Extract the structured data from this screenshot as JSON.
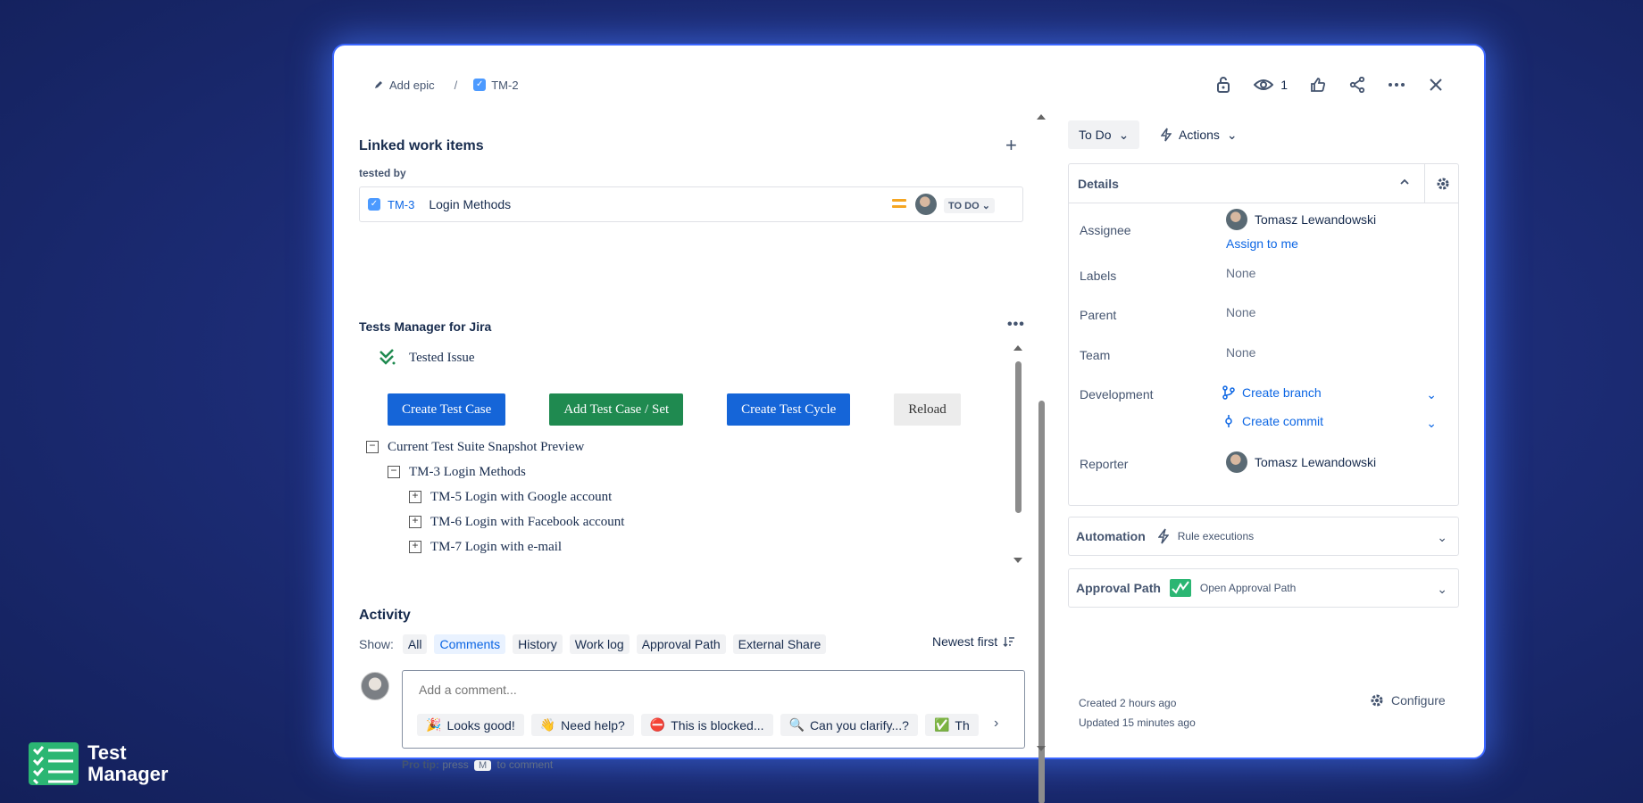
{
  "breadcrumb": {
    "add_epic": "Add epic",
    "sep": "/",
    "issue_key": "TM-2"
  },
  "top_actions": {
    "watch_count": "1"
  },
  "linked": {
    "title": "Linked work items",
    "relation": "tested by",
    "item": {
      "key": "TM-3",
      "summary": "Login Methods",
      "status": "TO DO"
    }
  },
  "tm": {
    "title": "Tests Manager for Jira",
    "tested_issue": "Tested Issue",
    "buttons": {
      "create_case": "Create Test Case",
      "add_case": "Add Test Case / Set",
      "create_cycle": "Create Test Cycle",
      "reload": "Reload"
    },
    "tree": [
      {
        "label": "Current Test Suite Snapshot Preview",
        "toggle": "−"
      },
      {
        "label": "TM-3 Login Methods",
        "toggle": "−"
      },
      {
        "label": "TM-5 Login with Google account",
        "toggle": "+"
      },
      {
        "label": "TM-6 Login with Facebook account",
        "toggle": "+"
      },
      {
        "label": "TM-7 Login with e-mail",
        "toggle": "+"
      }
    ]
  },
  "activity": {
    "title": "Activity",
    "show_label": "Show:",
    "tabs": [
      "All",
      "Comments",
      "History",
      "Work log",
      "Approval Path",
      "External Share"
    ],
    "active_tab": "Comments",
    "sort": "Newest first",
    "comment_placeholder": "Add a comment...",
    "chips": [
      {
        "emoji": "🎉",
        "label": "Looks good!"
      },
      {
        "emoji": "👋",
        "label": "Need help?"
      },
      {
        "emoji": "⛔",
        "label": "This is blocked..."
      },
      {
        "emoji": "🔍",
        "label": "Can you clarify...?"
      },
      {
        "emoji": "✅",
        "label": "Th"
      }
    ],
    "protip_label": "Pro tip:",
    "protip_press": "press",
    "protip_key": "M",
    "protip_rest": "to comment"
  },
  "sidebar": {
    "status": "To Do",
    "actions": "Actions",
    "details_title": "Details",
    "fields": {
      "assignee_label": "Assignee",
      "assignee": "Tomasz Lewandowski",
      "assign_to_me": "Assign to me",
      "labels_label": "Labels",
      "labels": "None",
      "parent_label": "Parent",
      "parent": "None",
      "team_label": "Team",
      "team": "None",
      "development_label": "Development",
      "create_branch": "Create branch",
      "create_commit": "Create commit",
      "reporter_label": "Reporter",
      "reporter": "Tomasz Lewandowski"
    },
    "automation": {
      "title": "Automation",
      "sub": "Rule executions"
    },
    "approval": {
      "title": "Approval Path",
      "sub": "Open Approval Path"
    },
    "created": "Created 2 hours ago",
    "updated": "Updated 15 minutes ago",
    "configure": "Configure"
  },
  "logo": {
    "line1": "Test",
    "line2": "Manager"
  },
  "colors": {
    "accent": "#0c66e4",
    "green_btn": "#1f8a50",
    "blue_btn": "#1565d8",
    "priority": "#f5a623"
  }
}
